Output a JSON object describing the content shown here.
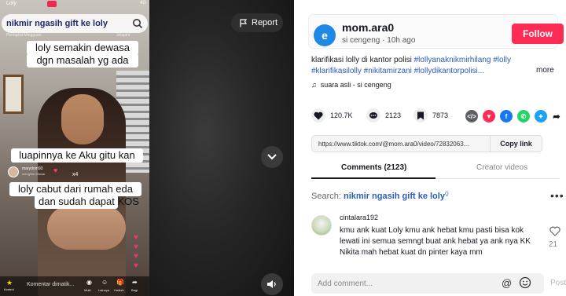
{
  "video": {
    "phone_time": "Loly",
    "phone_status": "4G",
    "phone_user": "Lolly",
    "search_query": "nikmir ngasih gift ke loly",
    "sub_left": "Peringkat Mingguan",
    "sub_right": "Jelajahi",
    "captions": {
      "line1": "loly semakin dewasa",
      "line1b": "dgn masalah yg ada",
      "line2": "luapinnya ke Aku gitu kan",
      "line3": "loly cabut dari rumah eda",
      "line3b": "dan sudah dapat KOS"
    },
    "mini_user": {
      "name": "marydom93",
      "sub": "mengirim Mawar",
      "count": "x4"
    },
    "bottom": {
      "comment_placeholder": "Komentar dimatik...",
      "ctrl_label": "Kontrol",
      "icons": [
        {
          "label": "Multi",
          "glyph": "◉"
        },
        {
          "label": "Lainnya",
          "glyph": "☺"
        },
        {
          "label": "Hadiah",
          "glyph": "🎁"
        },
        {
          "label": "Bagi",
          "glyph": "➦"
        }
      ]
    },
    "report_label": "Report"
  },
  "author": {
    "avatar_letter": "e",
    "username": "mom.ara0",
    "meta": "si cengeng · 10h ago",
    "follow_label": "Follow"
  },
  "description": {
    "text": "klarifikasi lolly di kantor polisi ",
    "tags1": "#lollyanaknikmirhilang #lolly",
    "line2": "#klarifikasilolly #nikitamirzani #lollydikantorpolisi...",
    "more": "more",
    "music": "suara asli - si cengeng"
  },
  "stats": {
    "likes": "120.7K",
    "comments": "2123",
    "saves": "7873"
  },
  "share_icons": [
    {
      "name": "embed",
      "color": "#5f6064",
      "glyph": "</>"
    },
    {
      "name": "send",
      "color": "#fe2c55",
      "glyph": "▼"
    },
    {
      "name": "facebook",
      "color": "#1877f2",
      "glyph": "f"
    },
    {
      "name": "whatsapp",
      "color": "#25d366",
      "glyph": "✆"
    },
    {
      "name": "twitter",
      "color": "#1da1f2",
      "glyph": "✦"
    }
  ],
  "link": {
    "url": "https://www.tiktok.com/@mom.ara0/video/72832063...",
    "copy_label": "Copy link"
  },
  "tabs": {
    "comments": "Comments (2123)",
    "creator": "Creator videos"
  },
  "search": {
    "prefix": "Search: ",
    "query": "nikmir ngasih gift ke loly",
    "suffix": "Q"
  },
  "comment": {
    "username": "cintalara192",
    "text": "kmu ank kuat Loly kmu ank hebat kmu pasti bisa kok lewati ini semua semngt buat ank hebat ya ank nya KK Nikita mah hebat kuat dn pinter kaya mm",
    "likes": "21"
  },
  "composer": {
    "placeholder": "Add comment...",
    "post_label": "Post"
  },
  "colors": {
    "accent": "#fe2c55",
    "link": "#2b5db9"
  }
}
